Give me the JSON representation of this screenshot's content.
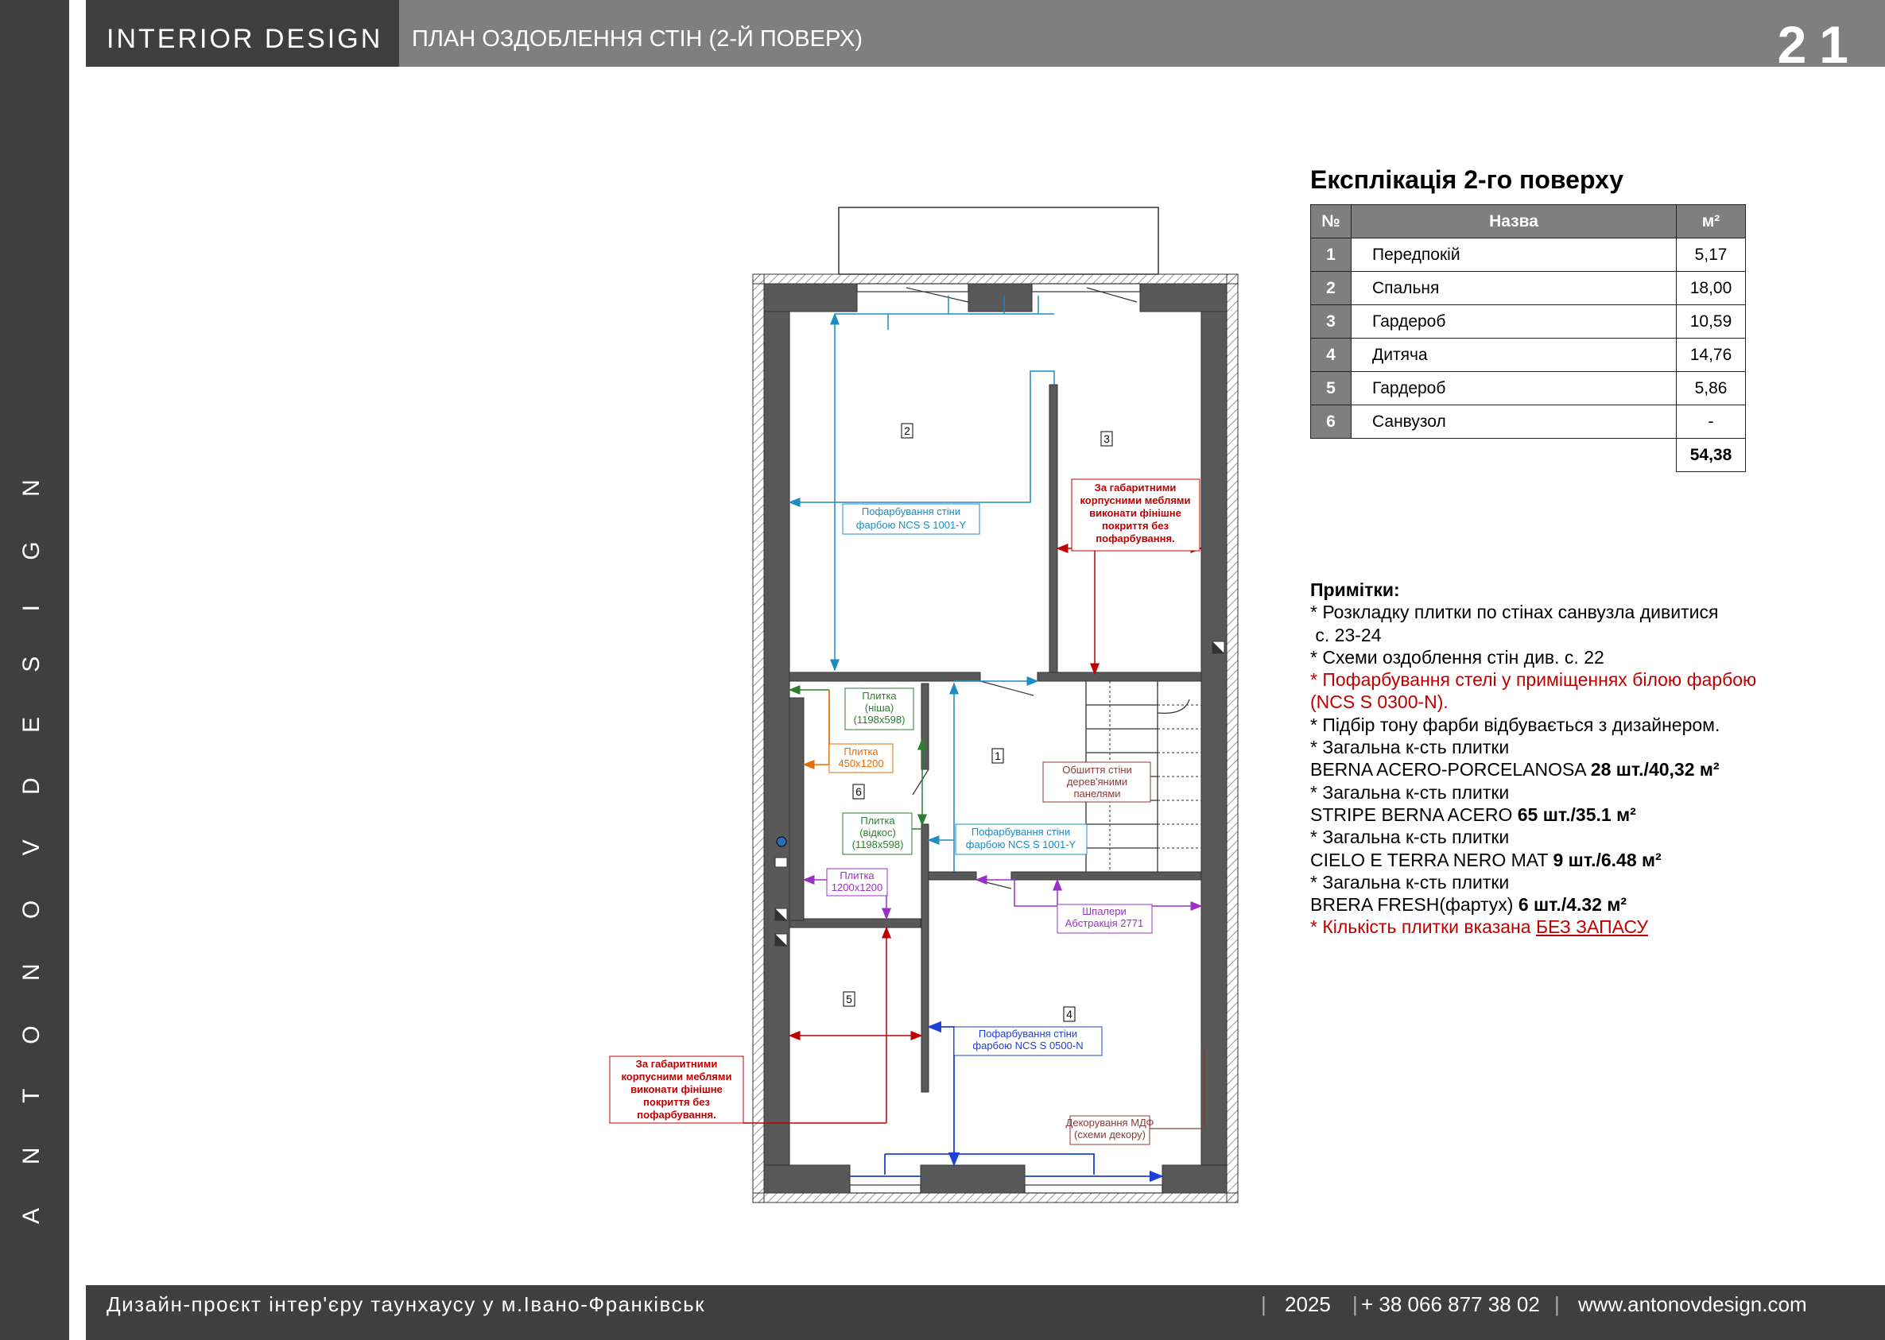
{
  "sidebar": {
    "text": "A N T O N O V   D E S I G N"
  },
  "header": {
    "brand": "INTERIOR  DESIGN",
    "title": "ПЛАН ОЗДОБЛЕННЯ СТІН (2-Й ПОВЕРХ)",
    "page": "21"
  },
  "explication": {
    "title": "Експлікація 2-го поверху",
    "col_no": "№",
    "col_name": "Назва",
    "col_area": "м²",
    "rows": [
      {
        "no": "1",
        "name": "Передпокій",
        "area": "5,17"
      },
      {
        "no": "2",
        "name": "Спальня",
        "area": "18,00"
      },
      {
        "no": "3",
        "name": "Гардероб",
        "area": "10,59"
      },
      {
        "no": "4",
        "name": "Дитяча",
        "area": "14,76"
      },
      {
        "no": "5",
        "name": "Гардероб",
        "area": "5,86"
      },
      {
        "no": "6",
        "name": "Санвузол",
        "area": "-"
      }
    ],
    "total": "54,38"
  },
  "notes": {
    "heading": "Примітки:",
    "n1a": "* Розкладку плитки по стінах санвузла дивитися",
    "n1b": " с. 23-24",
    "n2": "* Схеми оздоблення стін див. с. 22",
    "n3a": "* Пофарбування стелі у приміщеннях білою фарбою",
    "n3b": "(NCS S 0300-N).",
    "n4": "* Підбір тону фарби відбувається з дизайнером.",
    "n5": "* Загальна к-сть плитки",
    "n5_name": "BERNA ACERO-PORCELANOSA ",
    "n5_qty": "28 шт./40,32 м²",
    "n6": "* Загальна к-сть плитки",
    "n6_name": "STRIPE BERNA ACERO ",
    "n6_qty": "65 шт./35.1 м²",
    "n7": "* Загальна к-сть плитки",
    "n7_name": "CIELO E TERRA NERO MAT ",
    "n7_qty": "9 шт./6.48 м²",
    "n8": "* Загальна к-сть плитки",
    "n8_name": "BRERA FRESH(фартух) ",
    "n8_qty": "6 шт./4.32 м²",
    "n9a": "* Кількість плитки вказана ",
    "n9b": "БЕЗ ЗАПАСУ"
  },
  "plan": {
    "rooms": [
      "1",
      "2",
      "3",
      "4",
      "5",
      "6"
    ],
    "paint_blue_l1": "Пофарбування стіни",
    "paint_blue_l2": "фарбою NCS S 1001-Y",
    "paint_blue2_l1": "Пофарбування стіни",
    "paint_blue2_l2": "фарбою NCS S 1001-Y",
    "paint_navy_l1": "Пофарбування стіни",
    "paint_navy_l2": "фарбою NCS S 0500-N",
    "red_note_l1": "За габаритними",
    "red_note_l2": "корпусними меблями",
    "red_note_l3": "виконати фінішне",
    "red_note_l4": "покриття без",
    "red_note_l5": "пофарбування.",
    "tile_niche_l1": "Плитка",
    "tile_niche_l2": "(ніша)",
    "tile_niche_l3": "(1198x598)",
    "tile_450_l1": "Плитка",
    "tile_450_l2": "450x1200",
    "tile_slope_l1": "Плитка",
    "tile_slope_l2": "(відкос)",
    "tile_slope_l3": "(1198x598)",
    "tile_1200_l1": "Плитка",
    "tile_1200_l2": "1200x1200",
    "wood_l1": "Обшиття стіни",
    "wood_l2": "дерев'яними",
    "wood_l3": "панелями",
    "wallpaper_l1": "Шпалери",
    "wallpaper_l2": "Абстракція 2771",
    "mdf_l1": "Декорування МДФ",
    "mdf_l2": "(схеми декору)"
  },
  "footer": {
    "project": "Дизайн-проєкт інтер'єру таунхаусу у м.Івано-Франківськ",
    "year": "2025",
    "phone": "+ 38 066 877 38 02",
    "site": "www.antonovdesign.com"
  },
  "colors": {
    "dark": "#3f3f3f",
    "header": "#7f7f7f",
    "wall": "#595959",
    "blue": "#1e8bc3",
    "red": "#c00000",
    "green": "#2e7d32",
    "orange": "#e46c0a",
    "purple": "#9b30c8",
    "navy": "#1f3fd6",
    "brown": "#8a3b3b"
  }
}
